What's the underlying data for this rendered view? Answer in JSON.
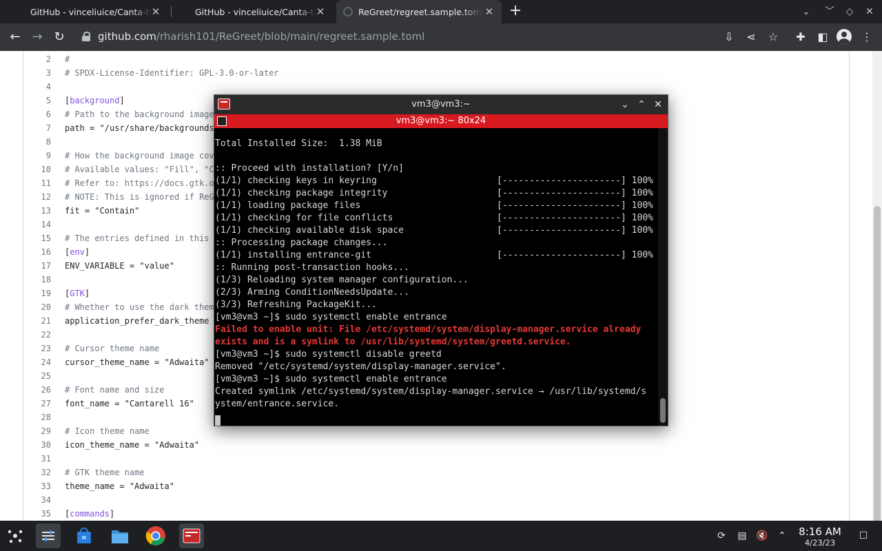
{
  "browser": {
    "tabs": [
      {
        "label": "GitHub - vinceliuice/Canta-theme",
        "active": false
      },
      {
        "label": "GitHub - vinceliuice/Canta-theme",
        "active": false
      },
      {
        "label": "ReGreet/regreet.sample.toml",
        "active": true
      }
    ],
    "url_host": "github.com",
    "url_path": "/rharish101/ReGreet/blob/main/regreet.sample.toml"
  },
  "code": {
    "lines": [
      {
        "n": "2",
        "text": "#",
        "kind": "comment"
      },
      {
        "n": "3",
        "text": "# SPDX-License-Identifier: GPL-3.0-or-later",
        "kind": "comment"
      },
      {
        "n": "4",
        "text": "",
        "kind": "plain"
      },
      {
        "n": "5",
        "text": "background",
        "kind": "section"
      },
      {
        "n": "6",
        "text": "# Path to the background image",
        "kind": "comment"
      },
      {
        "n": "7",
        "text": "path = \"/usr/share/backgrounds",
        "kind": "kv"
      },
      {
        "n": "8",
        "text": "",
        "kind": "plain"
      },
      {
        "n": "9",
        "text": "# How the background image cov",
        "kind": "comment"
      },
      {
        "n": "10",
        "text": "# Available values: \"Fill\", \"C",
        "kind": "comment"
      },
      {
        "n": "11",
        "text": "# Refer to: https://docs.gtk.o",
        "kind": "comment"
      },
      {
        "n": "12",
        "text": "# NOTE: This is ignored if ReG",
        "kind": "comment"
      },
      {
        "n": "13",
        "text": "fit = \"Contain\"",
        "kind": "kv"
      },
      {
        "n": "14",
        "text": "",
        "kind": "plain"
      },
      {
        "n": "15",
        "text": "# The entries defined in this",
        "kind": "comment"
      },
      {
        "n": "16",
        "text": "env",
        "kind": "section"
      },
      {
        "n": "17",
        "text": "ENV_VARIABLE = \"value\"",
        "kind": "kv"
      },
      {
        "n": "18",
        "text": "",
        "kind": "plain"
      },
      {
        "n": "19",
        "text": "GTK",
        "kind": "section"
      },
      {
        "n": "20",
        "text": "# Whether to use the dark them",
        "kind": "comment"
      },
      {
        "n": "21",
        "text": "application_prefer_dark_theme",
        "kind": "kv"
      },
      {
        "n": "22",
        "text": "",
        "kind": "plain"
      },
      {
        "n": "23",
        "text": "# Cursor theme name",
        "kind": "comment"
      },
      {
        "n": "24",
        "text": "cursor_theme_name = \"Adwaita\"",
        "kind": "kv"
      },
      {
        "n": "25",
        "text": "",
        "kind": "plain"
      },
      {
        "n": "26",
        "text": "# Font name and size",
        "kind": "comment"
      },
      {
        "n": "27",
        "text": "font_name = \"Cantarell 16\"",
        "kind": "kv"
      },
      {
        "n": "28",
        "text": "",
        "kind": "plain"
      },
      {
        "n": "29",
        "text": "# Icon theme name",
        "kind": "comment"
      },
      {
        "n": "30",
        "text": "icon_theme_name = \"Adwaita\"",
        "kind": "kv"
      },
      {
        "n": "31",
        "text": "",
        "kind": "plain"
      },
      {
        "n": "32",
        "text": "# GTK theme name",
        "kind": "comment"
      },
      {
        "n": "33",
        "text": "theme_name = \"Adwaita\"",
        "kind": "kv"
      },
      {
        "n": "34",
        "text": "",
        "kind": "plain"
      },
      {
        "n": "35",
        "text": "commands",
        "kind": "section"
      }
    ]
  },
  "terminal": {
    "window_title": "vm3@vm3:~",
    "tab_title": "vm3@vm3:~ 80x24",
    "lines": [
      {
        "text": "",
        "prog": "",
        "kind": "out"
      },
      {
        "text": "Total Installed Size:  1.38 MiB",
        "prog": "",
        "kind": "out"
      },
      {
        "text": "",
        "prog": "",
        "kind": "out"
      },
      {
        "text": ":: Proceed with installation? [Y/n]",
        "prog": "",
        "kind": "out"
      },
      {
        "text": "(1/1) checking keys in keyring",
        "prog": "[----------------------] 100%",
        "kind": "out"
      },
      {
        "text": "(1/1) checking package integrity",
        "prog": "[----------------------] 100%",
        "kind": "out"
      },
      {
        "text": "(1/1) loading package files",
        "prog": "[----------------------] 100%",
        "kind": "out"
      },
      {
        "text": "(1/1) checking for file conflicts",
        "prog": "[----------------------] 100%",
        "kind": "out"
      },
      {
        "text": "(1/1) checking available disk space",
        "prog": "[----------------------] 100%",
        "kind": "out"
      },
      {
        "text": ":: Processing package changes...",
        "prog": "",
        "kind": "out"
      },
      {
        "text": "(1/1) installing entrance-git",
        "prog": "[----------------------] 100%",
        "kind": "out"
      },
      {
        "text": ":: Running post-transaction hooks...",
        "prog": "",
        "kind": "out"
      },
      {
        "text": "(1/3) Reloading system manager configuration...",
        "prog": "",
        "kind": "out"
      },
      {
        "text": "(2/3) Arming ConditionNeedsUpdate...",
        "prog": "",
        "kind": "out"
      },
      {
        "text": "(3/3) Refreshing PackageKit...",
        "prog": "",
        "kind": "out"
      },
      {
        "text": "[vm3@vm3 ~]$ sudo systemctl enable entrance",
        "prog": "",
        "kind": "out"
      },
      {
        "text": "Failed to enable unit: File /etc/systemd/system/display-manager.service already",
        "prog": "",
        "kind": "err"
      },
      {
        "text": "exists and is a symlink to /usr/lib/systemd/system/greetd.service.",
        "prog": "",
        "kind": "err"
      },
      {
        "text": "[vm3@vm3 ~]$ sudo systemctl disable greetd",
        "prog": "",
        "kind": "out"
      },
      {
        "text": "Removed \"/etc/systemd/system/display-manager.service\".",
        "prog": "",
        "kind": "out"
      },
      {
        "text": "[vm3@vm3 ~]$ sudo systemctl enable entrance",
        "prog": "",
        "kind": "out"
      },
      {
        "text": "Created symlink /etc/systemd/system/display-manager.service → /usr/lib/systemd/s",
        "prog": "",
        "kind": "out"
      },
      {
        "text": "ystem/entrance.service.",
        "prog": "",
        "kind": "out"
      }
    ]
  },
  "taskbar": {
    "time": "8:16 AM",
    "date": "4/23/23"
  },
  "colors": {
    "terminal_tab_red": "#d71920",
    "error_red": "#e53935",
    "section_purple": "#8250df"
  }
}
